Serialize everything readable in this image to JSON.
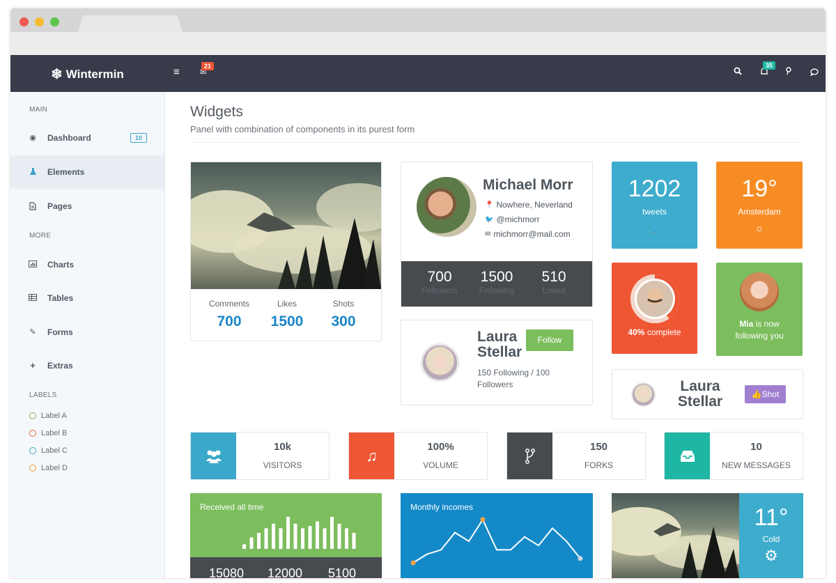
{
  "app": {
    "brand": "Wintermin",
    "mail_badge": "21",
    "bell_badge": "35"
  },
  "sidebar": {
    "main_label": "MAIN",
    "more_label": "MORE",
    "labels_label": "LABELS",
    "items": [
      {
        "label": "Dashboard",
        "icon": "dashboard-icon",
        "badge": "10"
      },
      {
        "label": "Elements",
        "icon": "flask-icon"
      },
      {
        "label": "Pages",
        "icon": "file-icon"
      },
      {
        "label": "Charts",
        "icon": "bar-chart-icon"
      },
      {
        "label": "Tables",
        "icon": "table-icon"
      },
      {
        "label": "Forms",
        "icon": "edit-icon"
      },
      {
        "label": "Extras",
        "icon": "plus-icon"
      }
    ],
    "labels": [
      {
        "label": "Label A",
        "color": "#7cb95b"
      },
      {
        "label": "Label B",
        "color": "#e8603c"
      },
      {
        "label": "Label C",
        "color": "#3ea9c4"
      },
      {
        "label": "Label D",
        "color": "#f5952d"
      }
    ]
  },
  "page": {
    "title": "Widgets",
    "subtitle": "Panel with combination of components in its purest form"
  },
  "photo_card": {
    "stats": [
      {
        "label": "Comments",
        "value": "700"
      },
      {
        "label": "Likes",
        "value": "1500"
      },
      {
        "label": "Shots",
        "value": "300"
      }
    ]
  },
  "profile": {
    "name": "Michael Morr",
    "location": "Nowhere, Neverland",
    "twitter": "@michmorr",
    "email": "michmorr@mail.com",
    "stats": [
      {
        "value": "700",
        "label": "Followers"
      },
      {
        "value": "1500",
        "label": "Following"
      },
      {
        "value": "510",
        "label": "Loved"
      }
    ]
  },
  "laura_follow": {
    "first": "Laura",
    "last": "Stellar",
    "button": "Follow",
    "meta": "150 Following / 100 Followers"
  },
  "tweets": {
    "value": "1202",
    "label": "tweets",
    "color": "#3daccd"
  },
  "weather1": {
    "value": "19°",
    "city": "Amsterdam",
    "color": "#f78c25"
  },
  "progress": {
    "percent": "40%",
    "label": "complete",
    "fraction": 0.4,
    "color": "#ef5634"
  },
  "mia": {
    "name": "Mia",
    "text": "is now following you",
    "color": "#7cbd5d"
  },
  "laura_shot": {
    "first": "Laura",
    "last": "Stellar",
    "button": "Shot",
    "color": "#a07fd0"
  },
  "stats4": [
    {
      "value": "10k",
      "label": "VISITORS",
      "icon": "users-icon",
      "color": "#3aa8ca"
    },
    {
      "value": "100%",
      "label": "VOLUME",
      "icon": "music-icon",
      "color": "#ef5634"
    },
    {
      "value": "150",
      "label": "FORKS",
      "icon": "fork-icon",
      "color": "#474b4f"
    },
    {
      "value": "10",
      "label": "NEW MESSAGES",
      "icon": "inbox-icon",
      "color": "#1eb7a4"
    }
  ],
  "received": {
    "title": "Received all time",
    "color": "#7cbd5d",
    "bars": [
      2,
      5,
      7,
      9,
      11,
      9,
      14,
      11,
      9,
      10,
      12,
      9,
      14,
      11,
      9,
      7
    ],
    "footer_values": [
      "15080",
      "12000",
      "5100"
    ]
  },
  "monthly": {
    "title": "Monthly incomes",
    "color": "#1489c8",
    "points": [
      2,
      4,
      5,
      9,
      7,
      12,
      5,
      5,
      8,
      6,
      10,
      7,
      3
    ]
  },
  "weather2": {
    "value": "11°",
    "label": "Cold",
    "color": "#3daccd"
  }
}
